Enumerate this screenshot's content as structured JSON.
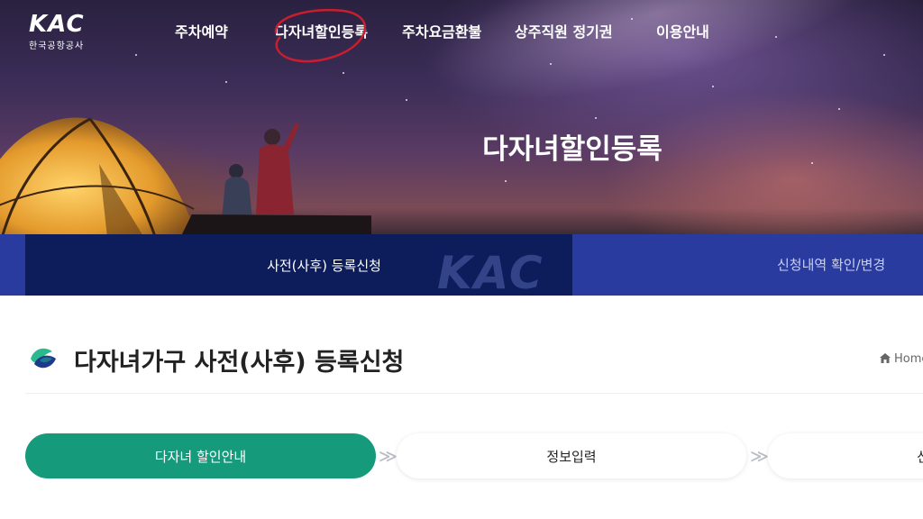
{
  "brand": {
    "logo_text": "KAC",
    "logo_subtitle": "한국공항공사"
  },
  "nav": {
    "items": [
      {
        "label": "주차예약"
      },
      {
        "label": "다자녀할인등록"
      },
      {
        "label": "주차요금환불"
      },
      {
        "label": "상주직원 정기권"
      },
      {
        "label": "이용안내"
      }
    ],
    "highlight_color": "#c81e2e"
  },
  "hero": {
    "title": "다자녀할인등록"
  },
  "tabs": {
    "active_label": "사전(사후) 등록신청",
    "other_label": "신청내역 확인/변경",
    "watermark": "KAC",
    "active_color": "#0d1c5a",
    "band_color": "#2a3ba0"
  },
  "page": {
    "title": "다자녀가구 사전(사후) 등록신청",
    "breadcrumb_home": "Home"
  },
  "steps": {
    "items": [
      {
        "label": "다자녀 할인안내"
      },
      {
        "label": "정보입력"
      },
      {
        "label": "신"
      }
    ],
    "active_color": "#169a7c",
    "separator": "≫"
  }
}
